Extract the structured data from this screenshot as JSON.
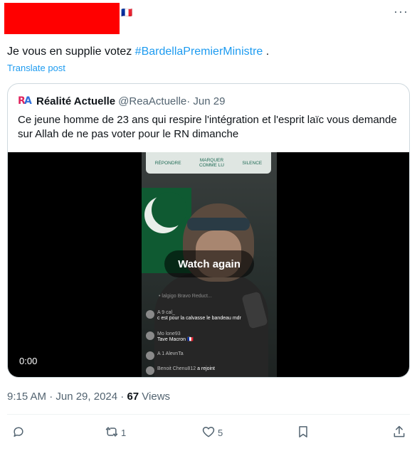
{
  "post": {
    "author_flag": "🇫🇷",
    "more_icon": "more-horizontal-icon",
    "text_prefix": "Je vous en supplie votez ",
    "hashtag": "#BardellaPremierMinistre",
    "text_suffix": " .",
    "translate_label": "Translate post",
    "timestamp": "9:15 AM · Jun 29, 2024 · ",
    "views_count": "67",
    "views_label": " Views"
  },
  "quote": {
    "avatar_letters": [
      "R",
      "A"
    ],
    "author_name": "Réalité Actuelle",
    "handle": "@ReaActuelle",
    "date": " · Jun 29",
    "text": "Ce jeune homme de 23 ans qui respire l'intégration et l'esprit laïc vous demande sur Allah de ne pas voter pour le RN dimanche",
    "video": {
      "overlay_buttons": [
        "RÉPONDRE",
        "MARQUER\nCOMME LU",
        "SILENCE"
      ],
      "ghost_text": "• lalgigo Bravo Reduct...",
      "comments": [
        {
          "user": "A 9 cal_",
          "message": "c est pour la calvasse le bandeau mdr"
        },
        {
          "user": "Mo lone93",
          "message": "Tave Macron 🇫🇷"
        },
        {
          "user": "A 1 AlevnTa",
          "message": ""
        },
        {
          "user": "Benoit Chenu812",
          "message": "a rejoint"
        }
      ],
      "watch_again_label": "Watch again",
      "time": "0:00"
    }
  },
  "actions": {
    "reply": {
      "icon": "reply-icon",
      "count": ""
    },
    "repost": {
      "icon": "repost-icon",
      "count": "1"
    },
    "like": {
      "icon": "heart-icon",
      "count": "5"
    },
    "bookmark": {
      "icon": "bookmark-icon",
      "count": ""
    },
    "share": {
      "icon": "share-icon",
      "count": ""
    }
  },
  "colors": {
    "accent": "#1d9bf0",
    "redaction": "#ff0000",
    "secondary_text": "#536471"
  }
}
